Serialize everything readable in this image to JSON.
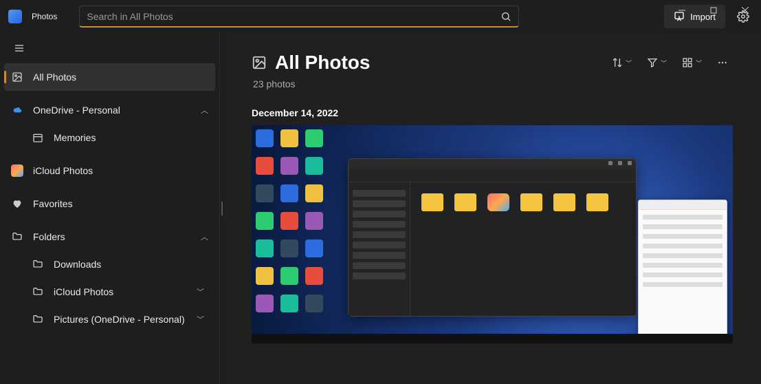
{
  "app": {
    "name": "Photos"
  },
  "search": {
    "placeholder": "Search in All Photos"
  },
  "titlebar": {
    "import_label": "Import"
  },
  "sidebar": {
    "all_photos": "All Photos",
    "onedrive": "OneDrive - Personal",
    "memories": "Memories",
    "icloud_photos": "iCloud Photos",
    "favorites": "Favorites",
    "folders": "Folders",
    "downloads": "Downloads",
    "icloud_folder": "iCloud Photos",
    "pictures_folder": "Pictures (OneDrive - Personal)"
  },
  "content": {
    "title": "All Photos",
    "subtitle": "23 photos",
    "date_header": "December 14, 2022"
  }
}
